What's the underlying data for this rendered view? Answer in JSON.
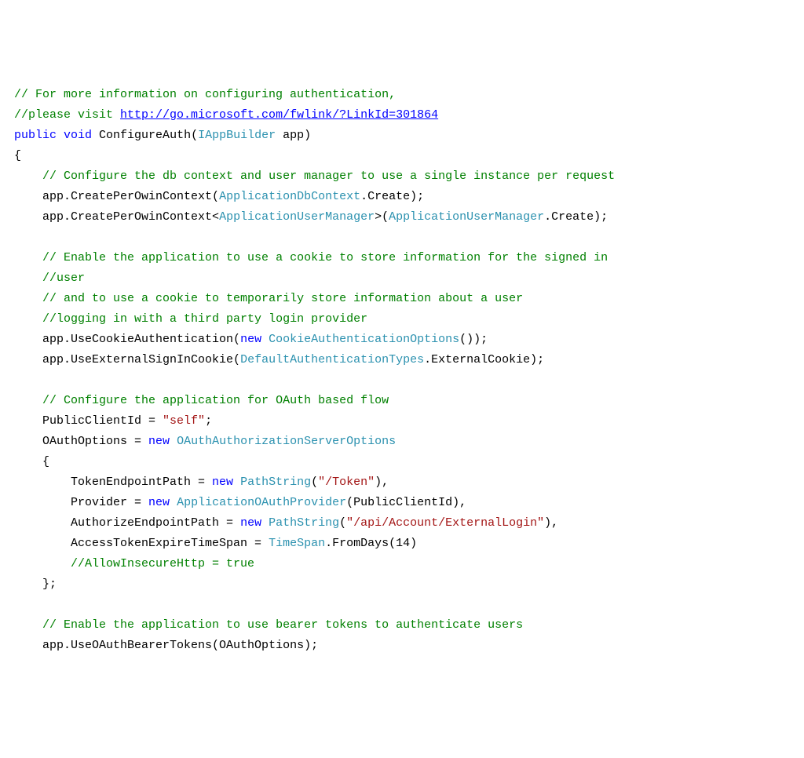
{
  "code": {
    "c1": "// For more information on configuring authentication, ",
    "c2a": "//please visit ",
    "c2link": "http://go.microsoft.com/fwlink/?LinkId=301864",
    "kpublic": "public",
    "kvoid": "void",
    "mname": " ConfigureAuth(",
    "tIAppBuilder": "IAppBuilder",
    "mend": " app)",
    "lbrace": "{",
    "indent1": "    ",
    "indent2": "        ",
    "c3": "// Configure the db context and user manager to use a single instance per request",
    "l4a": "app.CreatePerOwinContext(",
    "tAppDb": "ApplicationDbContext",
    "l4b": ".Create);",
    "l5a": "app.CreatePerOwinContext<",
    "tAUM": "ApplicationUserManager",
    "l5b": ">(",
    "l5c": ".Create);",
    "c6": "// Enable the application to use a cookie to store information for the signed in ",
    "c6b": "//user",
    "c7": "// and to use a cookie to temporarily store information about a user ",
    "c7b": "//logging in with a third party login provider",
    "l8a": "app.UseCookieAuthentication(",
    "knew": "new",
    "tCAO": "CookieAuthenticationOptions",
    "l8b": "());",
    "l9a": "app.UseExternalSignInCookie(",
    "tDAT": "DefaultAuthenticationTypes",
    "l9b": ".ExternalCookie);",
    "c10": "// Configure the application for OAuth based flow",
    "l11a": "PublicClientId = ",
    "sSelf": "\"self\"",
    "semi": ";",
    "l12a": "OAuthOptions = ",
    "tOASO": "OAuthAuthorizationServerOptions",
    "l13": "{",
    "l14a": "TokenEndpointPath = ",
    "tPathS": "PathString",
    "l14b": "(",
    "sToken": "\"/Token\"",
    "comma": "),",
    "l15a": "Provider = ",
    "tAOP": "ApplicationOAuthProvider",
    "l15b": "(PublicClientId),",
    "l16a": "AuthorizeEndpointPath = ",
    "sExt": "\"/api/Account/ExternalLogin\"",
    "l17a": "AccessTokenExpireTimeSpan = ",
    "tTS": "TimeSpan",
    "l17b": ".FromDays(14)",
    "c18": "//AllowInsecureHttp = true",
    "l19": "};",
    "c20": "// Enable the application to use bearer tokens to authenticate users",
    "l21": "app.UseOAuthBearerTokens(OAuthOptions);"
  }
}
